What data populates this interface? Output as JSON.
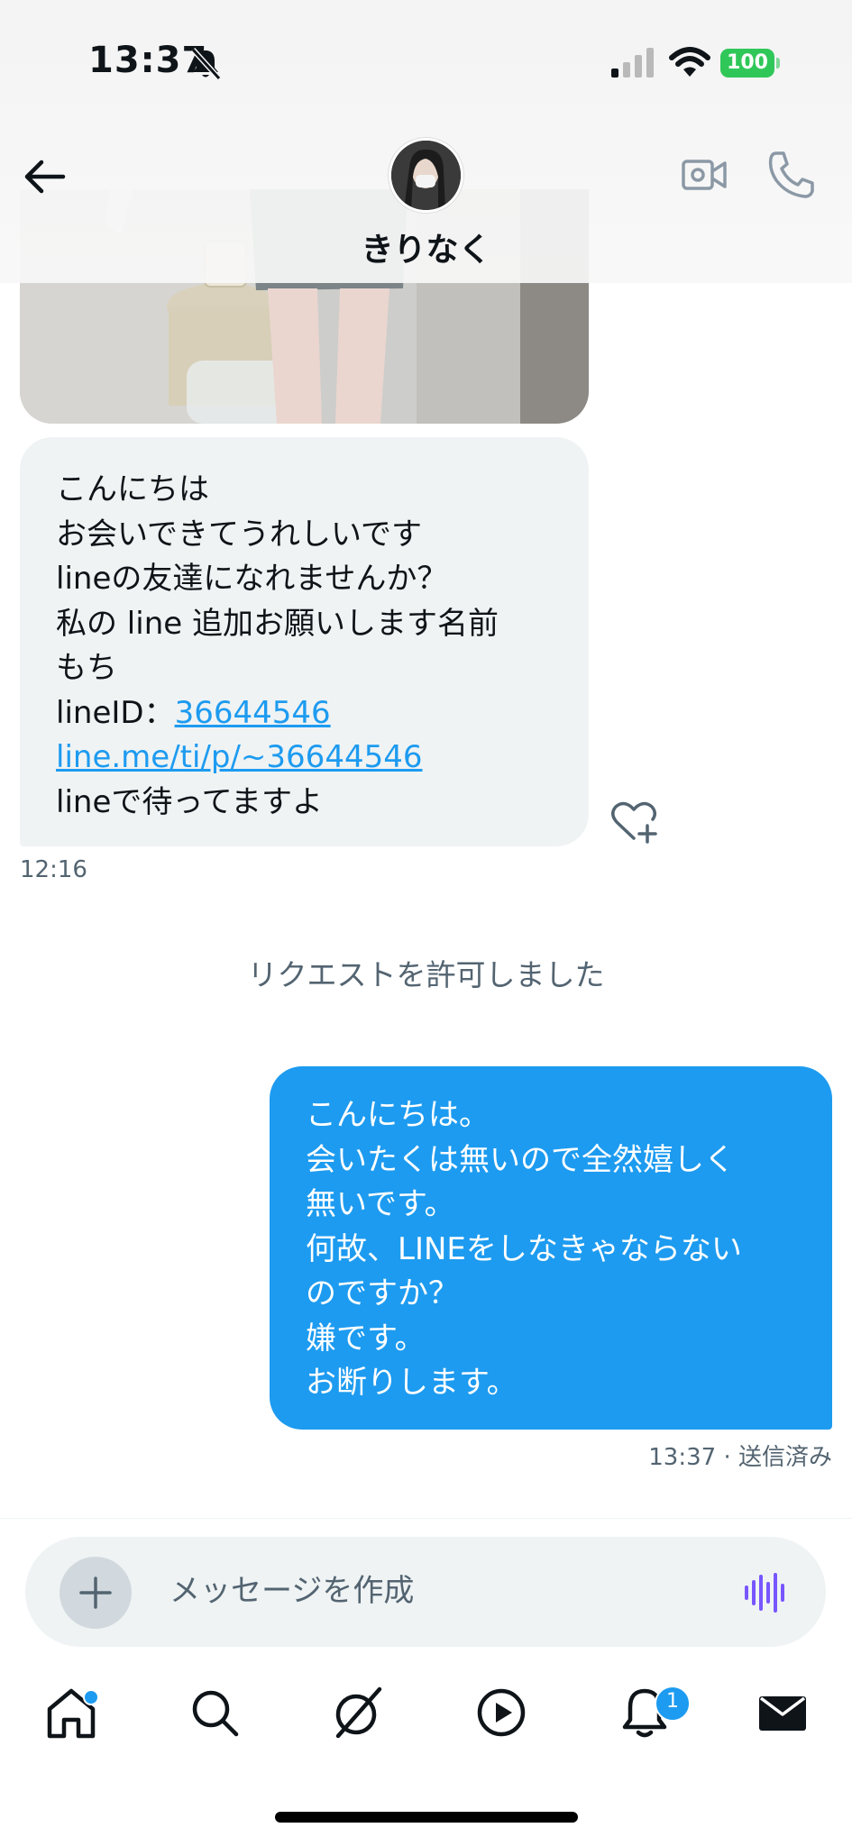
{
  "status_bar": {
    "time": "13:37",
    "battery": "100"
  },
  "header": {
    "contact_name": "きりなく"
  },
  "messages": {
    "incoming": {
      "lines": [
        "こんにちは",
        "お会いできてうれしいです",
        "lineの友達になれませんか？",
        "私の line 追加お願いします名前",
        "もち"
      ],
      "id_label": "lineID：",
      "id_value": "36644546",
      "link": "line.me/ti/p/~36644546",
      "last_line": "lineで待ってますよ",
      "time": "12:16"
    },
    "system": "リクエストを許可しました",
    "outgoing": {
      "lines": [
        "こんにちは。",
        "会いたくは無いので全然嬉しく",
        "無いです。",
        "何故、LINEをしなきゃならない",
        "のですか？",
        "嫌です。",
        "お断りします。"
      ],
      "time": "13:37 · 送信済み"
    }
  },
  "composer": {
    "placeholder": "メッセージを作成"
  },
  "tabbar": {
    "items": [
      "home-icon",
      "search-icon",
      "grok-icon",
      "play-icon",
      "bell-icon",
      "mail-icon"
    ],
    "notifications_badge": "1"
  },
  "colors": {
    "accent": "#1d9bf0",
    "incoming_bubble": "#eff3f4",
    "battery": "#30c759"
  }
}
